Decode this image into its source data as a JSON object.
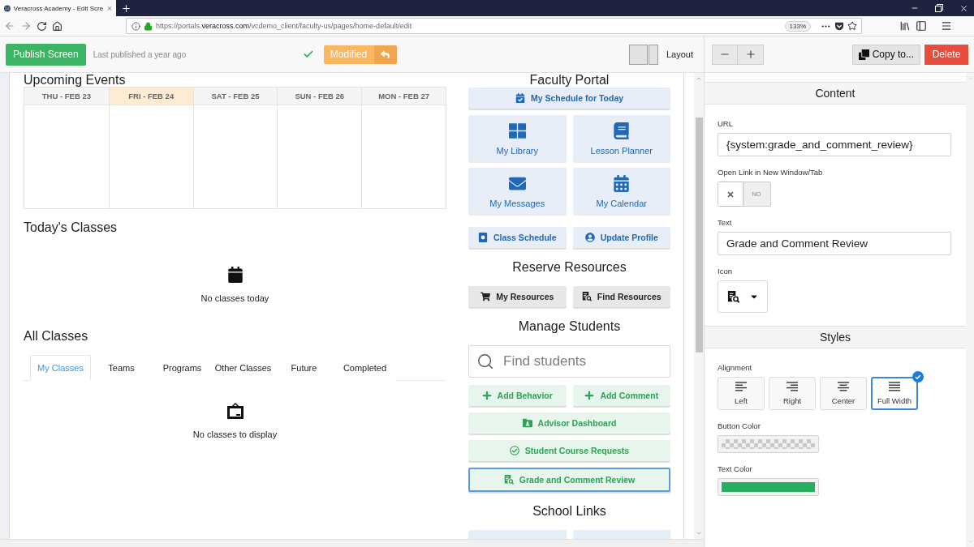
{
  "browser": {
    "tab_title": "Veracross Academy - Edit Scre",
    "url": "https://portals.**veracross.com**/vcdemo_client/faculty-us/pages/home-default/edit",
    "zoom": "133%"
  },
  "editor_toolbar": {
    "publish_button": "Publish Screen",
    "last_published": "Last published a year ago",
    "status_button": "Modified",
    "layout_label": "Layout",
    "copy_button": "Copy to...",
    "delete_button": "Delete"
  },
  "upcoming_events": {
    "title": "Upcoming Events",
    "days": [
      {
        "label": "THU - FEB 23",
        "today": false
      },
      {
        "label": "FRI - FEB 24",
        "today": true
      },
      {
        "label": "SAT - FEB 25",
        "today": false
      },
      {
        "label": "SUN - FEB 26",
        "today": false
      },
      {
        "label": "MON - FEB 27",
        "today": false
      }
    ]
  },
  "todays_classes": {
    "title": "Today's Classes",
    "empty_text": "No classes today"
  },
  "all_classes": {
    "title": "All Classes",
    "tabs": [
      {
        "label": "My Classes",
        "selected": true
      },
      {
        "label": "Teams",
        "selected": false
      },
      {
        "label": "Programs",
        "selected": false
      },
      {
        "label": "Other Classes",
        "selected": false
      },
      {
        "label": "Future",
        "selected": false
      },
      {
        "label": "Completed",
        "selected": false
      }
    ],
    "empty_text": "No classes to display"
  },
  "portal_sections": [
    {
      "title": "Faculty Portal",
      "items": [
        {
          "kind": "wide",
          "label": "My Schedule for Today",
          "color": "#2168b8",
          "selected": false
        },
        {
          "kind": "tile",
          "label": "My Library",
          "color": "#2168b8",
          "selected": false
        },
        {
          "kind": "tile",
          "label": "Lesson Planner",
          "color": "#2168b8",
          "selected": false
        },
        {
          "kind": "tile",
          "label": "My Messages",
          "color": "#2168b8",
          "selected": false
        },
        {
          "kind": "tile",
          "label": "My Calendar",
          "color": "#2168b8",
          "selected": false
        },
        {
          "kind": "half",
          "label": "Class Schedule",
          "color": "#2168b8",
          "selected": false
        },
        {
          "kind": "half",
          "label": "Update Profile",
          "color": "#2168b8",
          "selected": false
        }
      ]
    },
    {
      "title": "Reserve Resources",
      "items": [
        {
          "kind": "half",
          "label": "My Resources",
          "color": "#222222",
          "selected": false
        },
        {
          "kind": "half",
          "label": "Find Resources",
          "color": "#222222",
          "selected": false
        }
      ]
    },
    {
      "title": "Manage Students",
      "search": {
        "placeholder": "Find students"
      },
      "items": [
        {
          "kind": "half",
          "label": "Add Behavior",
          "color": "#2ea355",
          "selected": false
        },
        {
          "kind": "half",
          "label": "Add Comment",
          "color": "#2ea355",
          "selected": false
        },
        {
          "kind": "wide",
          "label": "Advisor Dashboard",
          "color": "#2ea355",
          "selected": false
        },
        {
          "kind": "wide",
          "label": "Student Course Requests",
          "color": "#2ea355",
          "selected": false
        },
        {
          "kind": "wide",
          "label": "Grade and Comment Review",
          "color": "#2ea355",
          "selected": true
        }
      ]
    },
    {
      "title": "School Links",
      "items": [
        {
          "kind": "tile",
          "selected": false
        },
        {
          "kind": "tile",
          "selected": false
        }
      ]
    }
  ],
  "content_section": {
    "title": "Content",
    "url_field": {
      "label": "URL",
      "value": "{system:grade_and_comment_review}"
    },
    "new_window": {
      "label": "Open Link in New Window/Tab",
      "on": false,
      "state_text": "NO"
    },
    "text_field": {
      "label": "Text",
      "value": "Grade and Comment Review"
    },
    "icon_field": {
      "label": "Icon"
    }
  },
  "styles_section": {
    "title": "Styles",
    "alignment": {
      "label": "Alignment",
      "options": [
        {
          "label": "Left",
          "selected": false
        },
        {
          "label": "Right",
          "selected": false
        },
        {
          "label": "Center",
          "selected": false
        },
        {
          "label": "Full Width",
          "selected": true
        }
      ]
    },
    "button_color": {
      "label": "Button Color",
      "transparent": true
    },
    "text_color": {
      "label": "Text Color",
      "color": "#27ae60"
    }
  }
}
